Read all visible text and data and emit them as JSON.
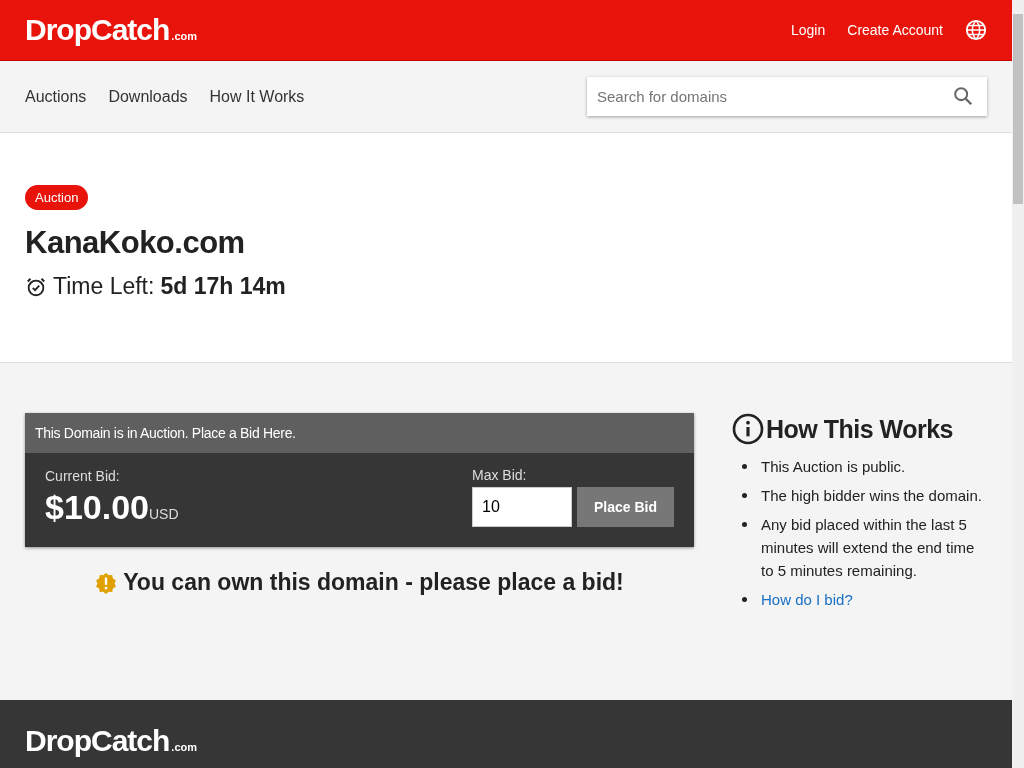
{
  "header": {
    "logo": {
      "name": "DropCatch",
      "suffix": ".com"
    },
    "links": [
      "Login",
      "Create Account"
    ]
  },
  "nav": {
    "items": [
      "Auctions",
      "Downloads",
      "How It Works"
    ],
    "search": {
      "placeholder": "Search for domains"
    }
  },
  "domain": {
    "badge": "Auction",
    "name": "KanaKoko.com",
    "time_label": "Time Left:",
    "time_value": "5d 17h 14m"
  },
  "bid_panel": {
    "title": "This Domain is in Auction. Place a Bid Here.",
    "current_label": "Current Bid:",
    "current_amount": "$10.00",
    "currency": "USD",
    "max_label": "Max Bid:",
    "max_value": "10",
    "button": "Place Bid"
  },
  "notice": "You can own this domain - please place a bid!",
  "how_it_works": {
    "title": "How This Works",
    "items": [
      {
        "kind": "text",
        "text": "This Auction is public."
      },
      {
        "kind": "text",
        "text": "The high bidder wins the domain."
      },
      {
        "kind": "text",
        "text": "Any bid placed within the last 5 minutes will extend the end time to 5 minutes remaining."
      },
      {
        "kind": "link",
        "text": "How do I bid?"
      }
    ]
  },
  "footer": {
    "logo": {
      "name": "DropCatch",
      "suffix": ".com"
    }
  }
}
